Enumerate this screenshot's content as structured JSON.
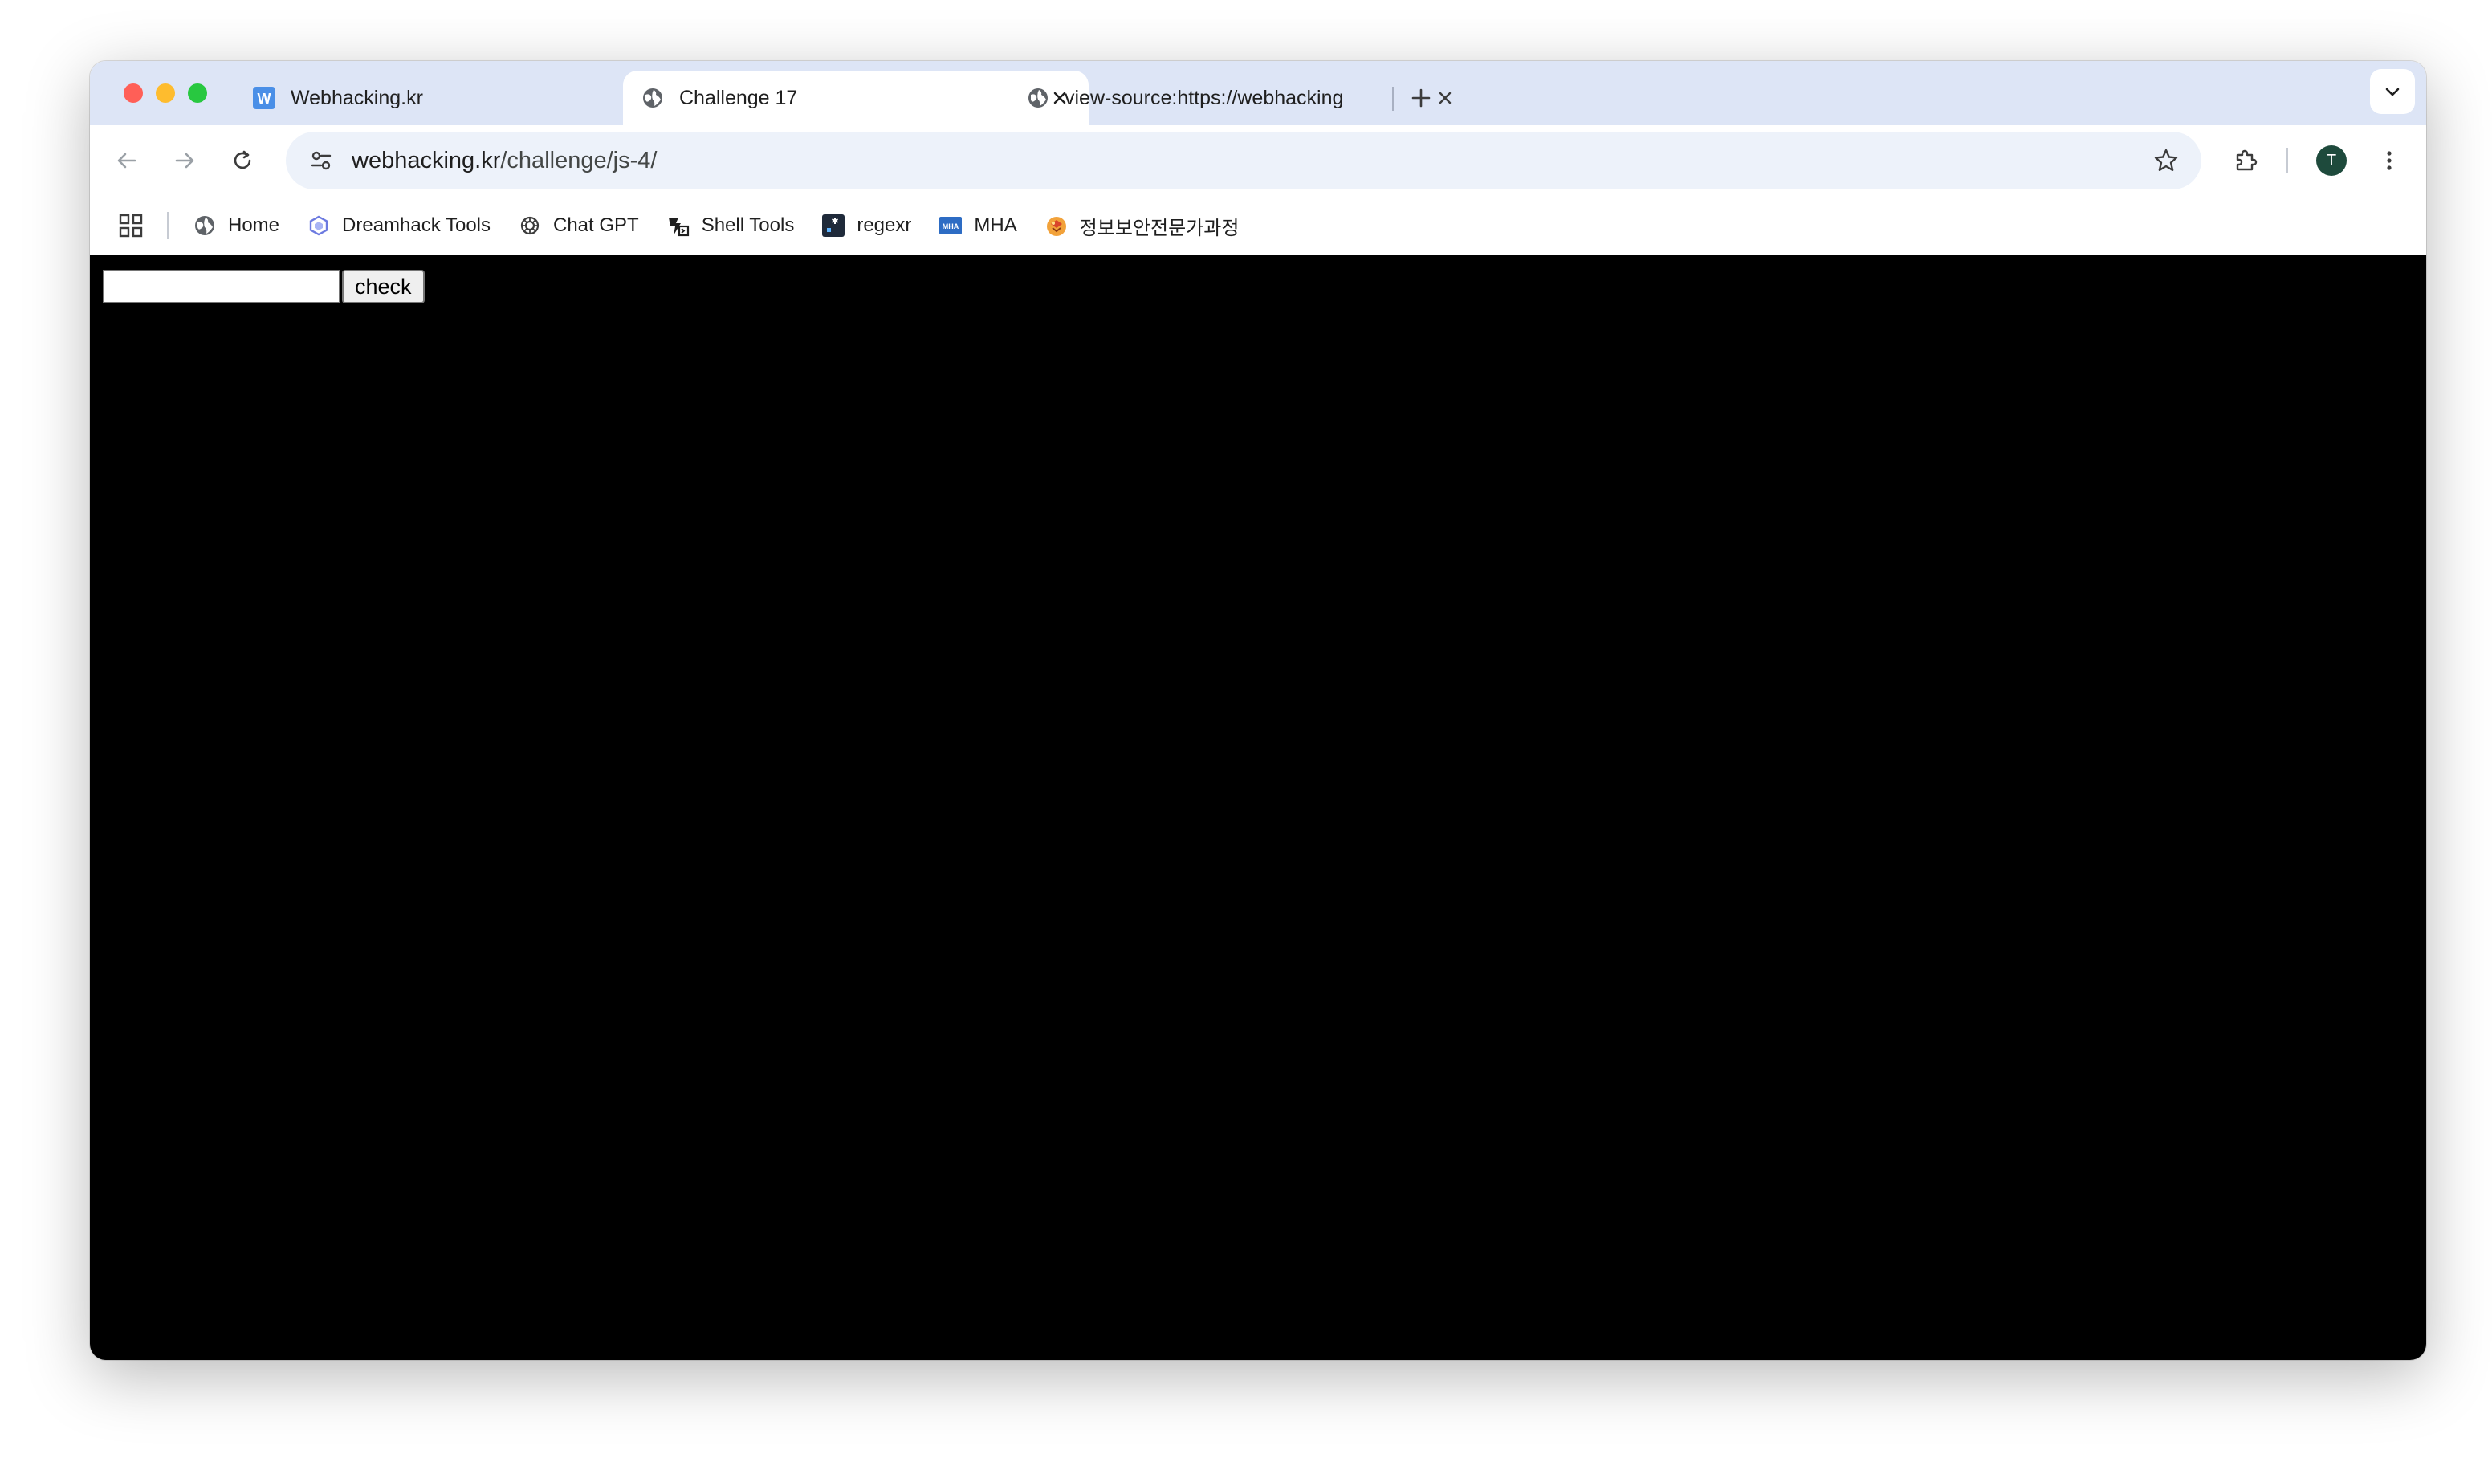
{
  "browser": {
    "tabs": [
      {
        "title": "Webhacking.kr",
        "favicon": "webhacking-w-icon",
        "active": false
      },
      {
        "title": "Challenge 17",
        "favicon": "globe-icon",
        "active": true
      },
      {
        "title": "view-source:https://webhacking",
        "favicon": "globe-icon",
        "active": false
      }
    ],
    "address": {
      "host": "webhacking.kr",
      "path": "/challenge/js-4/"
    },
    "profile_initial": "T",
    "bookmarks": [
      {
        "label": "Home",
        "icon": "globe-icon"
      },
      {
        "label": "Dreamhack Tools",
        "icon": "dreamhack-icon"
      },
      {
        "label": "Chat GPT",
        "icon": "openai-icon"
      },
      {
        "label": "Shell Tools",
        "icon": "shell-tools-icon"
      },
      {
        "label": "regexr",
        "icon": "regexr-icon"
      },
      {
        "label": "MHA",
        "icon": "mha-icon"
      },
      {
        "label": "정보보안전문가과정",
        "icon": "course-icon"
      }
    ]
  },
  "page": {
    "input_value": "",
    "check_label": "check"
  },
  "colors": {
    "tabstrip": "#dde5f6",
    "omnibox": "#edf2fa",
    "content_bg": "#000000",
    "avatar": "#1e4a3c"
  }
}
